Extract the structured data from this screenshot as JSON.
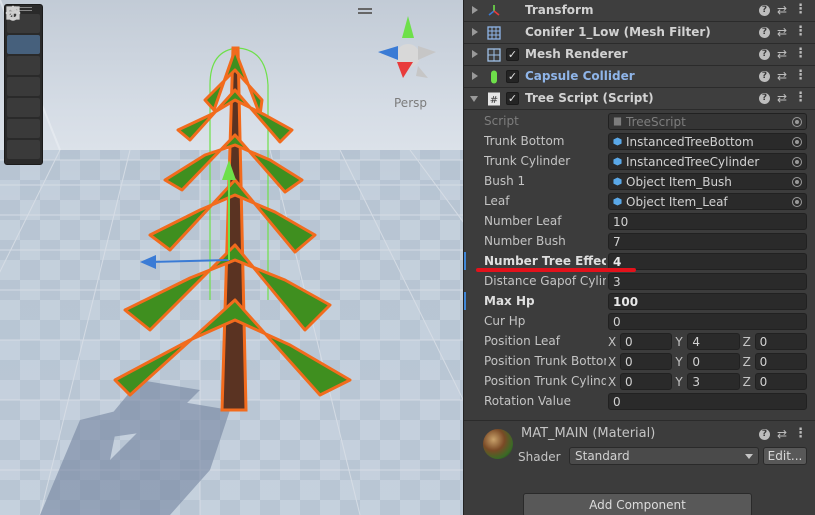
{
  "scene": {
    "persp_label": "Persp",
    "tools": [
      "hand-tool",
      "move-tool",
      "rotate-tool",
      "scale-tool",
      "rect-tool",
      "transform-tool",
      "custom-tool"
    ],
    "active_tool": "move-tool"
  },
  "components": [
    {
      "title": "Transform",
      "icon": "transform-icon",
      "expanded": false,
      "has_checkbox": false
    },
    {
      "title": "Conifer 1_Low (Mesh Filter)",
      "icon": "mesh-filter-icon",
      "expanded": false,
      "has_checkbox": false
    },
    {
      "title": "Mesh Renderer",
      "icon": "mesh-renderer-icon",
      "expanded": false,
      "has_checkbox": true
    },
    {
      "title": "Capsule Collider",
      "icon": "capsule-collider-icon",
      "expanded": false,
      "has_checkbox": true,
      "highlight": true
    },
    {
      "title": "Tree Script (Script)",
      "icon": "script-icon",
      "expanded": true,
      "has_checkbox": true
    }
  ],
  "tree_script": {
    "script": {
      "label": "Script",
      "value": "TreeScript"
    },
    "trunk_bottom": {
      "label": "Trunk Bottom",
      "value": "InstancedTreeBottom"
    },
    "trunk_cylinder": {
      "label": "Trunk Cylinder",
      "value": "InstancedTreeCylinder"
    },
    "bush_1": {
      "label": "Bush 1",
      "value": "Object Item_Bush"
    },
    "leaf": {
      "label": "Leaf",
      "value": "Object Item_Leaf"
    },
    "number_leaf": {
      "label": "Number Leaf",
      "value": "10"
    },
    "number_bush": {
      "label": "Number Bush",
      "value": "7"
    },
    "number_tree_effect": {
      "label": "Number Tree Effect",
      "value": "4"
    },
    "distance_gap": {
      "label": "Distance Gapof Cylinder",
      "value": "3"
    },
    "max_hp": {
      "label": "Max Hp",
      "value": "100"
    },
    "cur_hp": {
      "label": "Cur Hp",
      "value": "0"
    },
    "position_leaf": {
      "label": "Position Leaf",
      "x": "0",
      "y": "4",
      "z": "0"
    },
    "position_trunk_bottom": {
      "label": "Position Trunk Bottom",
      "x": "0",
      "y": "0",
      "z": "0"
    },
    "position_trunk_cylinder": {
      "label": "Position Trunk Cylinder",
      "x": "0",
      "y": "3",
      "z": "0"
    },
    "rotation_value": {
      "label": "Rotation Value",
      "value": "0"
    }
  },
  "axes": {
    "x": "X",
    "y": "Y",
    "z": "Z"
  },
  "material": {
    "name": "MAT_MAIN (Material)",
    "shader_label": "Shader",
    "shader_value": "Standard",
    "edit_label": "Edit..."
  },
  "add_component_label": "Add Component",
  "header_icons": {
    "help": "?",
    "settings": "⇄",
    "menu": "⋮"
  },
  "colors": {
    "accent_blue": "#8fb5e9",
    "modified_mark": "#3f86d6",
    "annotation_red": "#e3121b",
    "selection_orange": "#f26b1d",
    "foliage_green": "#3f8f1f"
  }
}
